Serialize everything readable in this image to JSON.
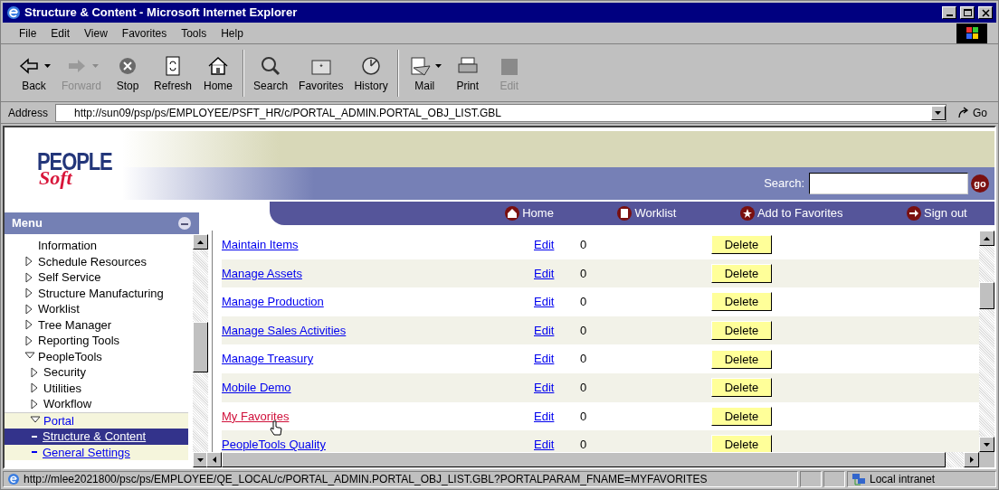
{
  "window": {
    "title": "Structure & Content - Microsoft Internet Explorer"
  },
  "menu_bar": [
    "File",
    "Edit",
    "View",
    "Favorites",
    "Tools",
    "Help"
  ],
  "toolbar": [
    {
      "label": "Back",
      "kind": "back",
      "disabled": false,
      "dropdown": true
    },
    {
      "label": "Forward",
      "kind": "forward",
      "disabled": true,
      "dropdown": true
    },
    {
      "label": "Stop",
      "kind": "stop",
      "disabled": false,
      "dropdown": false
    },
    {
      "label": "Refresh",
      "kind": "refresh",
      "disabled": false,
      "dropdown": false
    },
    {
      "label": "Home",
      "kind": "home",
      "disabled": false,
      "dropdown": false
    },
    {
      "label": "Search",
      "kind": "search",
      "disabled": false,
      "dropdown": false
    },
    {
      "label": "Favorites",
      "kind": "favorites",
      "disabled": false,
      "dropdown": false
    },
    {
      "label": "History",
      "kind": "history",
      "disabled": false,
      "dropdown": false
    },
    {
      "label": "Mail",
      "kind": "mail",
      "disabled": false,
      "dropdown": true
    },
    {
      "label": "Print",
      "kind": "print",
      "disabled": false,
      "dropdown": false
    },
    {
      "label": "Edit",
      "kind": "edit",
      "disabled": true,
      "dropdown": false
    }
  ],
  "address_bar": {
    "label": "Address",
    "url": "http://sun09/psp/ps/EMPLOYEE/PSFT_HR/c/PORTAL_ADMIN.PORTAL_OBJ_LIST.GBL",
    "go": "Go"
  },
  "header": {
    "logo": {
      "top": "PEOPLE",
      "bottom": "Soft"
    },
    "search_label": "Search:",
    "go": "go",
    "nav": [
      {
        "label": "Home",
        "kind": "home"
      },
      {
        "label": "Worklist",
        "kind": "worklist"
      },
      {
        "label": "Add to Favorites",
        "kind": "favorites"
      },
      {
        "label": "Sign out",
        "kind": "signout"
      }
    ]
  },
  "menu": {
    "title": "Menu",
    "items": [
      {
        "label": "Information",
        "kind": "text"
      },
      {
        "label": "Schedule Resources",
        "kind": "folder",
        "expanded": false
      },
      {
        "label": "Self Service",
        "kind": "folder",
        "expanded": false
      },
      {
        "label": "Structure Manufacturing",
        "kind": "folder",
        "expanded": false
      },
      {
        "label": "Worklist",
        "kind": "folder",
        "expanded": false
      },
      {
        "label": "Tree Manager",
        "kind": "folder",
        "expanded": false
      },
      {
        "label": "Reporting Tools",
        "kind": "folder",
        "expanded": false
      },
      {
        "label": "PeopleTools",
        "kind": "folder",
        "expanded": true,
        "children": [
          {
            "label": "Security",
            "kind": "folder",
            "expanded": false
          },
          {
            "label": "Utilities",
            "kind": "folder",
            "expanded": false
          },
          {
            "label": "Workflow",
            "kind": "folder",
            "expanded": false
          },
          {
            "label": "Portal",
            "kind": "folder",
            "expanded": true,
            "children": [
              {
                "label": "Structure & Content",
                "kind": "link",
                "selected": true
              },
              {
                "label": "General Settings",
                "kind": "link",
                "selected": false
              }
            ]
          }
        ]
      }
    ]
  },
  "table": {
    "rows": [
      {
        "name": "Maintain Items",
        "edit": "Edit",
        "count": "0",
        "delete": "Delete",
        "hovered": false
      },
      {
        "name": "Manage Assets",
        "edit": "Edit",
        "count": "0",
        "delete": "Delete",
        "hovered": false
      },
      {
        "name": "Manage Production",
        "edit": "Edit",
        "count": "0",
        "delete": "Delete",
        "hovered": false
      },
      {
        "name": "Manage Sales Activities",
        "edit": "Edit",
        "count": "0",
        "delete": "Delete",
        "hovered": false
      },
      {
        "name": "Manage Treasury",
        "edit": "Edit",
        "count": "0",
        "delete": "Delete",
        "hovered": false
      },
      {
        "name": "Mobile Demo",
        "edit": "Edit",
        "count": "0",
        "delete": "Delete",
        "hovered": false
      },
      {
        "name": "My Favorites",
        "edit": "Edit",
        "count": "0",
        "delete": "Delete",
        "hovered": true
      },
      {
        "name": "PeopleTools Quality",
        "edit": "Edit",
        "count": "0",
        "delete": "Delete",
        "hovered": false
      }
    ]
  },
  "status_bar": {
    "url": "http://mlee2021800/psc/ps/EMPLOYEE/QE_LOCAL/c/PORTAL_ADMIN.PORTAL_OBJ_LIST.GBL?PORTALPARAM_FNAME=MYFAVORITES",
    "zone": "Local intranet"
  }
}
